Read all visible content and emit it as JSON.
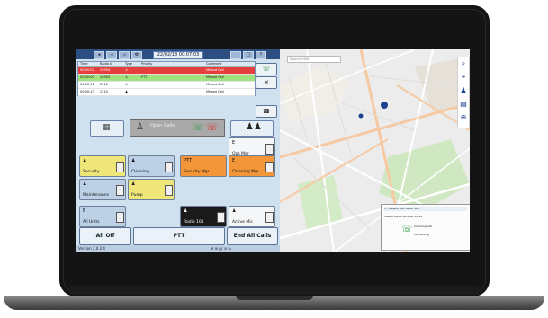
{
  "dispatch": {
    "clock": "22/02/18 00:07:03",
    "table_headers": [
      "Time",
      "Radio Id",
      "Type",
      "Priority",
      "",
      "Comment"
    ],
    "table_rows": [
      [
        "00:00:02",
        "20304",
        "",
        "",
        "",
        "Missed Call"
      ],
      [
        "00:00:00",
        "20303",
        "",
        "PTT",
        "",
        "Missed Call"
      ],
      [
        "00:00:11",
        "2210",
        "",
        "",
        "",
        "Missed Call"
      ],
      [
        "00:00:13",
        "2210",
        "",
        "",
        "",
        "Missed Call"
      ]
    ],
    "function_label": "Open Calls",
    "talkgroups": [
      {
        "name": "Ops Mgr",
        "icon": "E"
      },
      {
        "name": "Security",
        "icon": ""
      },
      {
        "name": "Cleaning",
        "icon": ""
      },
      {
        "name": "Security Mgr",
        "icon": "PTT"
      },
      {
        "name": "Cleaning Mgr",
        "icon": "E"
      },
      {
        "name": "Maintenance",
        "icon": ""
      },
      {
        "name": "Pump",
        "icon": ""
      },
      {
        "name": "All Units",
        "icon": "E"
      },
      {
        "name": "Radio 101",
        "icon": ""
      },
      {
        "name": "Active Mic",
        "icon": ""
      }
    ],
    "bottom": {
      "all_off": "All Off",
      "ptt": "PTT",
      "end_all_calls": "End All Calls"
    },
    "version": "Version 2.0.2.4",
    "status_icons": "⊞ ⊞ ▤ ☏ ⌂"
  },
  "map": {
    "search_placeholder": "Search OSM",
    "popup": {
      "header": "1 / 4  Radio 101  Radio 101",
      "row1": "Missed   Radio Simplex  10:28",
      "row2": "Incoming call",
      "row3": "Call ending"
    }
  },
  "colors": {
    "panel_bg": "#cfe0ef",
    "title_bar": "#2d4e80",
    "talk_yellow": "#efe67a",
    "talk_orange": "#f39639",
    "missed_call_red": "#e63d3d",
    "missed_call_green": "#9fe07f",
    "map_pin": "#1c3f8f"
  },
  "icons": {
    "search": "search-icon",
    "location": "location-icon",
    "group": "group-icon",
    "list": "list-icon",
    "zoom": "zoom-icon",
    "phone": "phone-icon",
    "close": "close-icon",
    "keypad": "keypad-icon",
    "person": "person-icon"
  }
}
